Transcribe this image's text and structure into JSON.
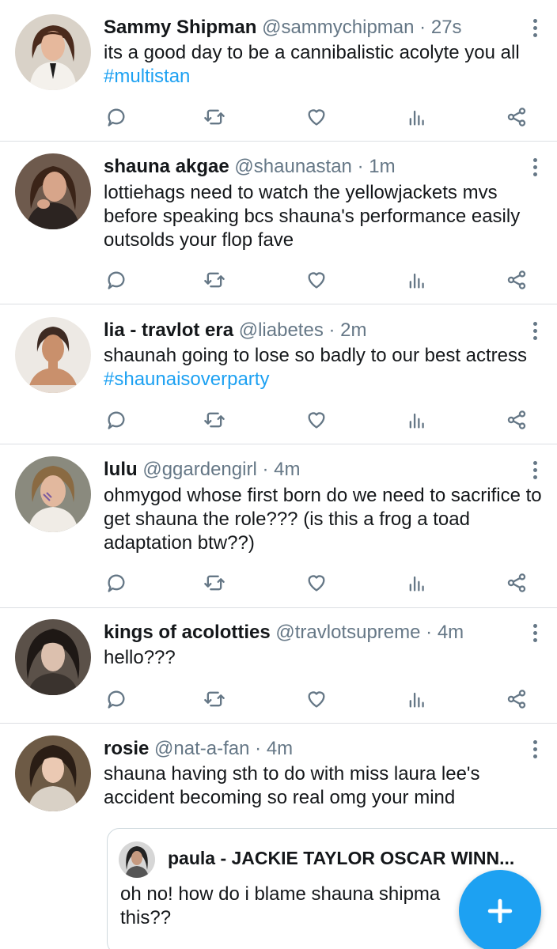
{
  "tweets": [
    {
      "name": "Sammy Shipman",
      "handle": "@sammychipman",
      "time": "27s",
      "text": "its a good day to be a cannibalistic acolyte you all ",
      "hashtag": "#multistan",
      "avatar_colors": {
        "bg": "#d9d2c8",
        "skin": "#e6b89c",
        "hair": "#4a2a1c",
        "shirt": "#f4f1ec"
      }
    },
    {
      "name": "shauna akgae",
      "handle": "@shaunastan",
      "time": "1m",
      "text": "lottiehags need to watch the yellowjackets mvs before speaking bcs shauna's performance easily outsolds your flop fave",
      "hashtag": "",
      "avatar_colors": {
        "bg": "#6e5a4d",
        "skin": "#d7a58a",
        "hair": "#3b2418",
        "shirt": "#2c2421"
      }
    },
    {
      "name": "lia - travlot era",
      "handle": "@liabetes",
      "time": "2m",
      "text": "shaunah going to lose so badly to our best actress ",
      "hashtag": "#shaunaisoverparty",
      "avatar_colors": {
        "bg": "#ede9e4",
        "skin": "#c9906c",
        "hair": "#3d2a22",
        "shirt": "#e7ddd4"
      }
    },
    {
      "name": "lulu",
      "handle": "@ggardengirl",
      "time": "4m",
      "text": "ohmygod whose first born do we need to sacrifice to get shauna the role??? (is this a frog a toad adaptation btw??)",
      "hashtag": "",
      "avatar_colors": {
        "bg": "#8a8a7e",
        "skin": "#e2b89e",
        "hair": "#8a6a42",
        "shirt": "#f0ece6"
      }
    },
    {
      "name": "kings of acolotties",
      "handle": "@travlotsupreme",
      "time": "4m",
      "text": "hello???",
      "hashtag": "",
      "avatar_colors": {
        "bg": "#5b5149",
        "skin": "#dcc0ae",
        "hair": "#1e1815",
        "shirt": "#3a332e"
      }
    },
    {
      "name": "rosie",
      "handle": "@nat-a-fan",
      "time": "4m",
      "text": "shauna having sth to do with miss laura lee's accident becoming so real omg your mind",
      "hashtag": "",
      "avatar_colors": {
        "bg": "#6d5a45",
        "skin": "#ebc9b3",
        "hair": "#2a1d15",
        "shirt": "#d9d1c6"
      }
    }
  ],
  "quote": {
    "name": "paula - JACKIE TAYLOR OSCAR WINN...",
    "text": "oh no! how do i blame shauna shipma this??",
    "avatar_colors": {
      "bg": "#d6d6d6",
      "skin": "#c69a80",
      "hair": "#222222",
      "shirt": "#555555"
    }
  },
  "separator_dot": "·",
  "fab_icon": "plus-icon",
  "colors": {
    "accent": "#1da1f2",
    "muted": "#657786",
    "divider": "#dcdfe3",
    "text": "#14171a"
  }
}
